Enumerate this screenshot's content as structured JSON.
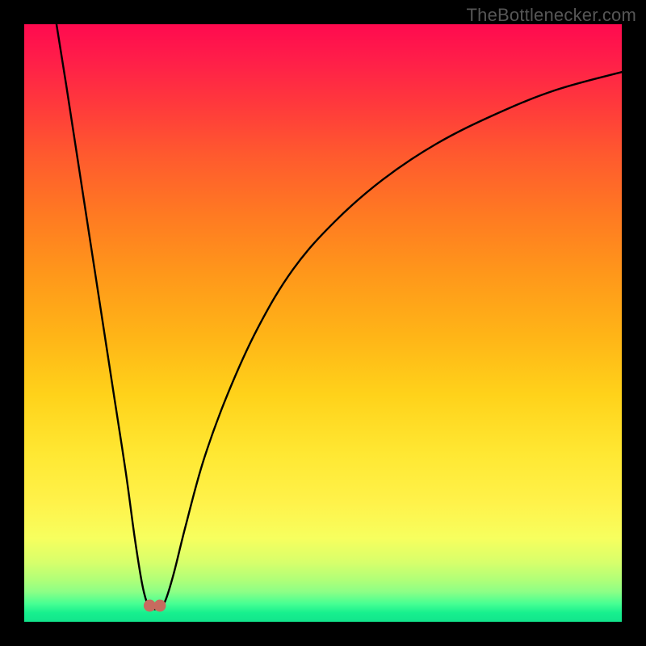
{
  "watermark": "TheBottlenecker.com",
  "chart_data": {
    "type": "line",
    "title": "",
    "xlabel": "",
    "ylabel": "",
    "xlim": [
      0,
      100
    ],
    "ylim": [
      0,
      100
    ],
    "series": [
      {
        "name": "left-branch",
        "x": [
          5.4,
          7,
          9,
          11,
          13,
          15,
          17,
          18.5,
          19.7,
          20.5,
          21.0
        ],
        "values": [
          100,
          90,
          77,
          64,
          51,
          38,
          25,
          14,
          6.5,
          3.3,
          2.7
        ]
      },
      {
        "name": "right-branch",
        "x": [
          22.7,
          23.6,
          25,
          27,
          30,
          34,
          39,
          45,
          52,
          60,
          69,
          79,
          89,
          100
        ],
        "values": [
          2.7,
          3.5,
          8,
          16,
          27,
          38,
          49,
          59,
          67,
          74,
          80,
          85,
          89,
          92
        ]
      }
    ],
    "nodes": [
      {
        "name": "min-left",
        "x": 21.0,
        "y": 2.7
      },
      {
        "name": "min-right",
        "x": 22.7,
        "y": 2.7
      }
    ],
    "background_gradient": {
      "direction": "vertical",
      "stops": [
        {
          "pos": 0.0,
          "color": "#ff0a4f"
        },
        {
          "pos": 0.32,
          "color": "#ff7a22"
        },
        {
          "pos": 0.62,
          "color": "#ffd21a"
        },
        {
          "pos": 0.86,
          "color": "#f7ff5e"
        },
        {
          "pos": 1.0,
          "color": "#12e58c"
        }
      ]
    }
  }
}
